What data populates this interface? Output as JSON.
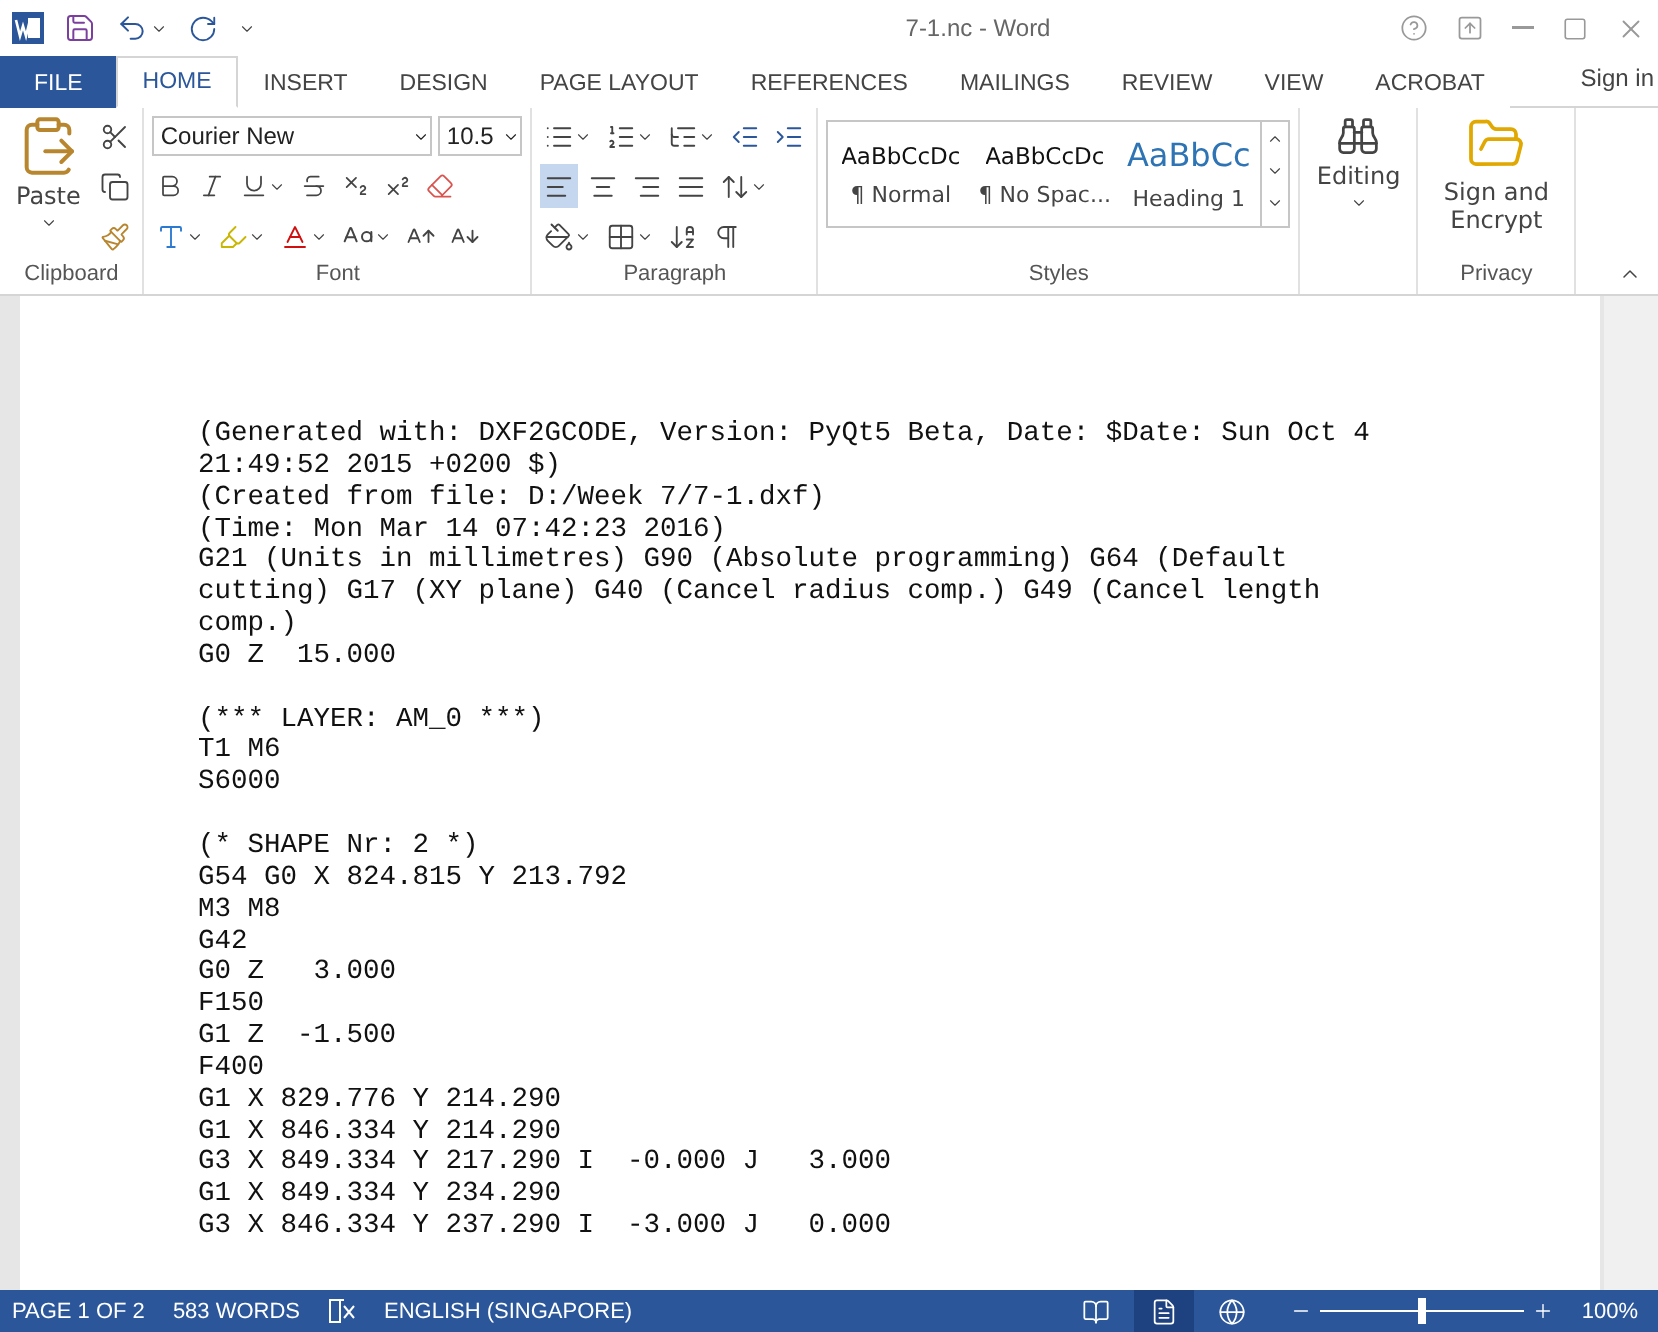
{
  "window": {
    "title": "7-1.nc - Word"
  },
  "tabs": [
    {
      "label": "FILE",
      "kind": "file",
      "selected": false
    },
    {
      "label": "HOME",
      "kind": "tab",
      "selected": true
    },
    {
      "label": "INSERT",
      "kind": "tab",
      "selected": false
    },
    {
      "label": "DESIGN",
      "kind": "tab",
      "selected": false
    },
    {
      "label": "PAGE LAYOUT",
      "kind": "tab",
      "selected": false
    },
    {
      "label": "REFERENCES",
      "kind": "tab",
      "selected": false
    },
    {
      "label": "MAILINGS",
      "kind": "tab",
      "selected": false
    },
    {
      "label": "REVIEW",
      "kind": "tab",
      "selected": false
    },
    {
      "label": "VIEW",
      "kind": "tab",
      "selected": false
    },
    {
      "label": "ACROBAT",
      "kind": "tab",
      "selected": false
    }
  ],
  "sign_in": "Sign in",
  "ribbon": {
    "clipboard": {
      "paste": "Paste",
      "label": "Clipboard"
    },
    "font": {
      "name": "Courier New",
      "size": "10.5",
      "label": "Font"
    },
    "paragraph": {
      "label": "Paragraph",
      "alignments": [
        {
          "kind": "left",
          "selected": true
        },
        {
          "kind": "center",
          "selected": false
        },
        {
          "kind": "right",
          "selected": false
        },
        {
          "kind": "justify",
          "selected": false
        }
      ]
    },
    "styles": {
      "label": "Styles",
      "items": [
        {
          "preview": "AaBbCcDc",
          "name": "¶ Normal",
          "kind": "body"
        },
        {
          "preview": "AaBbCcDc",
          "name": "¶ No Spac...",
          "kind": "body"
        },
        {
          "preview": "AaBbCc",
          "name": "Heading 1",
          "kind": "heading"
        }
      ]
    },
    "editing": {
      "label": "Editing"
    },
    "privacy": {
      "button": "Sign and Encrypt",
      "label": "Privacy"
    }
  },
  "document": {
    "blocks": [
      [
        "(Generated with: DXF2GCODE, Version: PyQt5 Beta, Date: $Date: Sun Oct 4 21:49:52 2015 +0200 $)",
        "(Created from file: D:/Week 7/7-1.dxf)",
        "(Time: Mon Mar 14 07:42:23 2016)",
        "G21 (Units in millimetres) G90 (Absolute programming) G64 (Default cutting) G17 (XY plane) G40 (Cancel radius comp.) G49 (Cancel length comp.)",
        "G0 Z  15.000"
      ],
      [
        "(*** LAYER: AM_0 ***)",
        "T1 M6",
        "S6000"
      ],
      [
        "(* SHAPE Nr: 2 *)",
        "G54 G0 X 824.815 Y 213.792",
        "M3 M8",
        "G42",
        "G0 Z   3.000",
        "F150",
        "G1 Z  -1.500",
        "F400",
        "G1 X 829.776 Y 214.290",
        "G1 X 846.334 Y 214.290",
        "G3 X 849.334 Y 217.290 I  -0.000 J   3.000",
        "G1 X 849.334 Y 234.290",
        "G3 X 846.334 Y 237.290 I  -3.000 J   0.000"
      ]
    ]
  },
  "status_bar": {
    "page": "PAGE 1 OF 2",
    "words": "583 WORDS",
    "language": "ENGLISH (SINGAPORE)",
    "views": [
      {
        "kind": "read",
        "selected": false
      },
      {
        "kind": "print",
        "selected": true
      },
      {
        "kind": "web",
        "selected": false
      }
    ],
    "zoom": {
      "level": 0.5,
      "reading": "100%"
    }
  }
}
